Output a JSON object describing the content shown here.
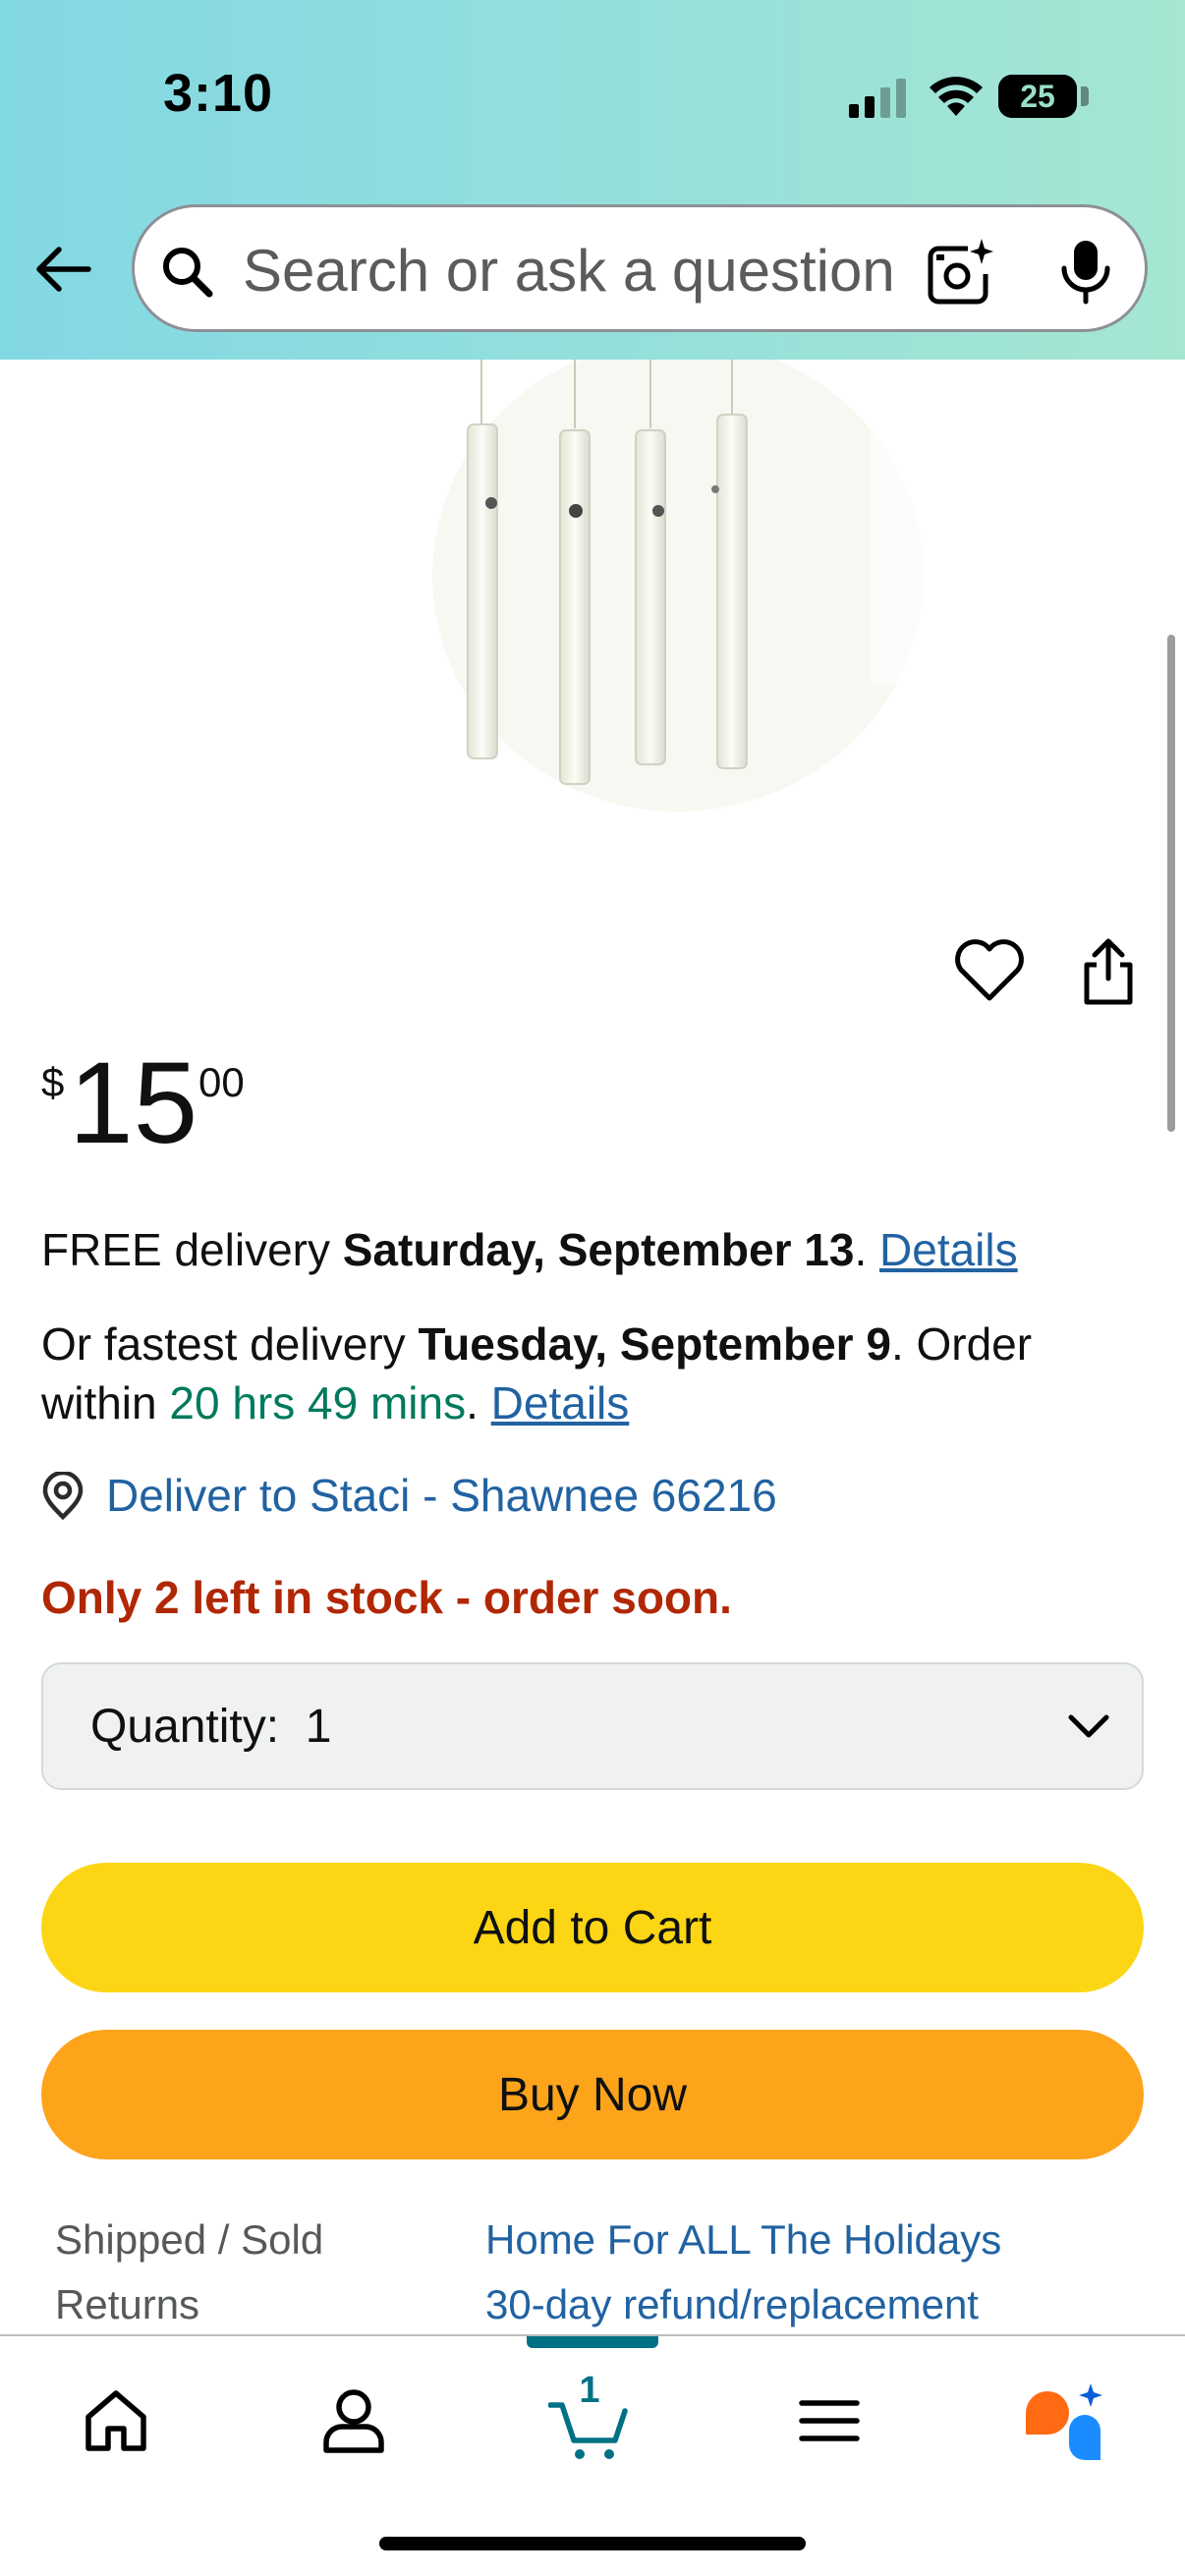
{
  "status_bar": {
    "time": "3:10",
    "battery": "25",
    "battery_level": 0.25
  },
  "header": {
    "back_icon": "arrow-left-icon",
    "search_placeholder": "Search or ask a question",
    "camera_icon": "camera-sparkle-icon",
    "mic_icon": "microphone-icon"
  },
  "product": {
    "image_alt": "wind chime",
    "price": {
      "symbol": "$",
      "whole": "15",
      "fraction": "00"
    }
  },
  "delivery": {
    "free_prefix": "FREE delivery ",
    "free_date": "Saturday, September 13",
    "free_suffix": ". ",
    "details_link": "Details",
    "fast_prefix": "Or fastest delivery ",
    "fast_date": "Tuesday, September 9",
    "fast_order": ". Order",
    "within_prefix": "within ",
    "within_time": "20 hrs 49 mins",
    "within_suffix": ". ",
    "details_link_2": "Details",
    "deliver_to": "Deliver to Staci - Shawnee 66216"
  },
  "stock": "Only 2 left in stock - order soon.",
  "quantity": {
    "label": "Quantity:",
    "value": "1"
  },
  "buttons": {
    "add_to_cart": "Add to Cart",
    "buy_now": "Buy Now"
  },
  "info": [
    {
      "key": "Shipped / Sold",
      "value": "Home For ALL The Holidays"
    },
    {
      "key": "Returns",
      "value": "30-day refund/replacement"
    }
  ],
  "bottom_nav": {
    "items": [
      "home-icon",
      "account-icon",
      "cart-icon",
      "menu-icon",
      "rufus-icon"
    ],
    "cart_count": "1"
  },
  "colors": {
    "header_gradient_start": "#82d8e3",
    "header_gradient_end": "#a6e6d2",
    "link": "#2162a1",
    "stock_red": "#b12704",
    "timer_green": "#007a5c",
    "add_to_cart": "#fcd614",
    "buy_now": "#fea41b",
    "nav_accent": "#007185"
  }
}
